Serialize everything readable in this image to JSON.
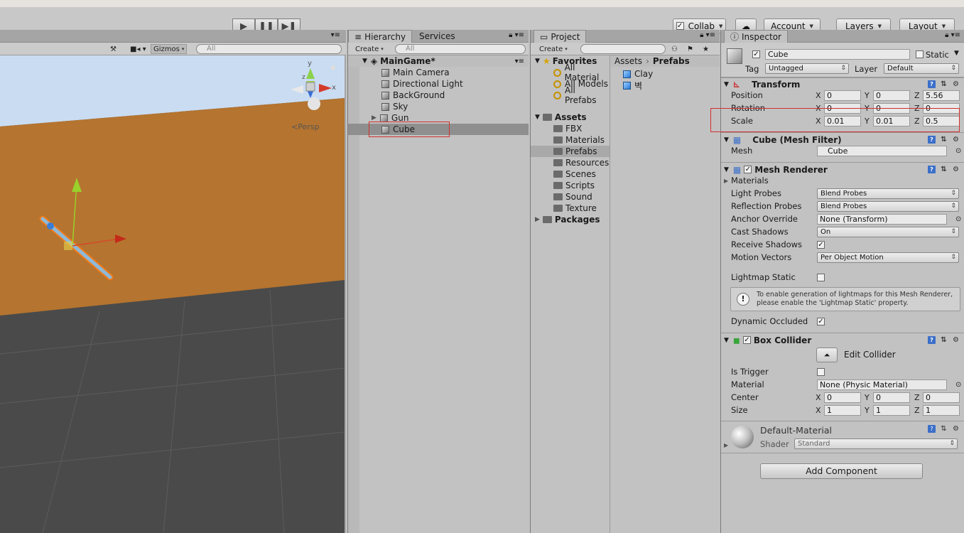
{
  "toolbar": {
    "collab_label": "Collab",
    "account_label": "Account",
    "layers_label": "Layers",
    "layout_label": "Layout"
  },
  "scene": {
    "gizmos_label": "Gizmos",
    "search_placeholder": "All",
    "persp_label": "<Persp",
    "axis_y": "y",
    "axis_x": "x",
    "axis_z": "z"
  },
  "hierarchy": {
    "tab_label": "Hierarchy",
    "services_tab_label": "Services",
    "create_label": "Create",
    "search_placeholder": "All",
    "scene_name": "MainGame*",
    "items": [
      {
        "label": "Main Camera"
      },
      {
        "label": "Directional Light"
      },
      {
        "label": "BackGround"
      },
      {
        "label": "Sky"
      },
      {
        "label": "Gun"
      },
      {
        "label": "Cube"
      }
    ]
  },
  "project": {
    "tab_label": "Project",
    "create_label": "Create",
    "favorites_label": "Favorites",
    "favorites": [
      "All Material",
      "All Models",
      "All Prefabs"
    ],
    "assets_label": "Assets",
    "asset_folders": [
      "FBX",
      "Materials",
      "Prefabs",
      "Resources",
      "Scenes",
      "Scripts",
      "Sound",
      "Texture"
    ],
    "packages_label": "Packages",
    "breadcrumb_root": "Assets",
    "breadcrumb_current": "Prefabs",
    "breadcrumb_sep": "›",
    "prefabs": [
      "Clay",
      "벽"
    ]
  },
  "inspector": {
    "tab_label": "Inspector",
    "object_name": "Cube",
    "static_label": "Static",
    "tag_label": "Tag",
    "tag_value": "Untagged",
    "layer_label": "Layer",
    "layer_value": "Default",
    "transform": {
      "title": "Transform",
      "position_label": "Position",
      "rotation_label": "Rotation",
      "scale_label": "Scale",
      "position": {
        "x": "0",
        "y": "0",
        "z": "5.56"
      },
      "rotation": {
        "x": "0",
        "y": "0",
        "z": "0"
      },
      "scale": {
        "x": "0.01",
        "y": "0.01",
        "z": "0.5"
      }
    },
    "mesh_filter": {
      "title": "Cube (Mesh Filter)",
      "mesh_label": "Mesh",
      "mesh_value": "Cube"
    },
    "mesh_renderer": {
      "title": "Mesh Renderer",
      "materials_label": "Materials",
      "light_probes_label": "Light Probes",
      "light_probes_value": "Blend Probes",
      "reflection_probes_label": "Reflection Probes",
      "reflection_probes_value": "Blend Probes",
      "anchor_override_label": "Anchor Override",
      "anchor_override_value": "None (Transform)",
      "cast_shadows_label": "Cast Shadows",
      "cast_shadows_value": "On",
      "receive_shadows_label": "Receive Shadows",
      "motion_vectors_label": "Motion Vectors",
      "motion_vectors_value": "Per Object Motion",
      "lightmap_static_label": "Lightmap Static",
      "info_text": "To enable generation of lightmaps for this Mesh Renderer, please enable the 'Lightmap Static' property.",
      "dynamic_occluded_label": "Dynamic Occluded"
    },
    "box_collider": {
      "title": "Box Collider",
      "edit_collider_label": "Edit Collider",
      "is_trigger_label": "Is Trigger",
      "material_label": "Material",
      "material_value": "None (Physic Material)",
      "center_label": "Center",
      "size_label": "Size",
      "center": {
        "x": "0",
        "y": "0",
        "z": "0"
      },
      "size": {
        "x": "1",
        "y": "1",
        "z": "1"
      }
    },
    "material": {
      "name": "Default-Material",
      "shader_label": "Shader",
      "shader_value": "Standard"
    },
    "add_component_label": "Add Component",
    "axis_labels": {
      "x": "X",
      "y": "Y",
      "z": "Z"
    }
  },
  "colors": {
    "highlight_red": "#d0302f",
    "sand": "#b5742f",
    "sky": "#c9dcf2",
    "selection": "#3d7bd8"
  }
}
